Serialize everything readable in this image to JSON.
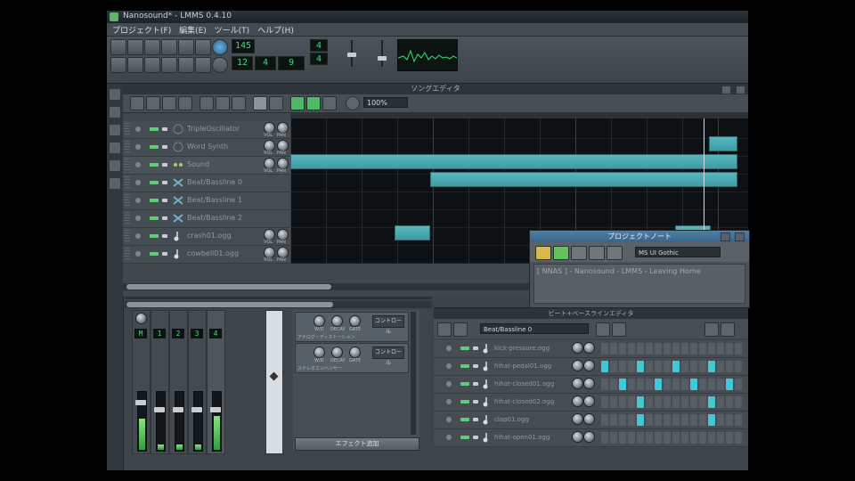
{
  "window": {
    "title": "Nanosound* - LMMS 0.4.10"
  },
  "menubar": {
    "items": [
      "プロジェクト(F)",
      "編集(E)",
      "ツール(T)",
      "ヘルプ(H)"
    ]
  },
  "toolbar": {
    "tempo": "145",
    "time_min": "12",
    "time_sec": "4",
    "time_ms": "9",
    "timesig_num": "4",
    "timesig_den": "4"
  },
  "song_editor": {
    "title": "ソングエディタ",
    "zoom": "100%",
    "tracks": [
      {
        "name": "TripleOscillator",
        "icon": "synth-icon",
        "has_knobs": true,
        "active": false
      },
      {
        "name": "Word Synth",
        "icon": "synth-icon",
        "has_knobs": true,
        "active": false
      },
      {
        "name": "Sound",
        "icon": "sampler-icon",
        "has_knobs": true,
        "active": true
      },
      {
        "name": "Beat/Bassline 0",
        "icon": "beat-icon",
        "has_knobs": false,
        "active": false
      },
      {
        "name": "Beat/Bassline 1",
        "icon": "beat-icon",
        "has_knobs": false,
        "active": false
      },
      {
        "name": "Beat/Bassline 2",
        "icon": "beat-icon",
        "has_knobs": false,
        "active": false
      },
      {
        "name": "crash01.ogg",
        "icon": "note-icon",
        "has_knobs": true,
        "active": false
      },
      {
        "name": "cowbell01.ogg",
        "icon": "note-icon",
        "has_knobs": true,
        "active": false
      }
    ]
  },
  "project_notes": {
    "title": "プロジェクトノート",
    "font": "MS UI Gothic",
    "text": "[ NNAS ] - Nanosound - LMMS - Leaving Home"
  },
  "fx_mixer": {
    "channels": [
      "M",
      "1",
      "2",
      "3",
      "4"
    ],
    "effects": [
      {
        "name": "アナログ・ディストーション",
        "control": "コントロール"
      },
      {
        "name": "ステレオエンハンサー",
        "control": "コントロール"
      }
    ],
    "add_effect": "エフェクト追加"
  },
  "beat_editor": {
    "title": "ビート+ベースラインエディタ",
    "selected": "Beat/Bassline 0",
    "rows": [
      {
        "name": "kick-pressure.ogg",
        "steps": [
          0,
          0,
          0,
          0,
          0,
          0,
          0,
          0,
          0,
          0,
          0,
          0,
          0,
          0,
          0,
          0
        ]
      },
      {
        "name": "hihat-pedal01.ogg",
        "steps": [
          1,
          0,
          0,
          0,
          1,
          0,
          0,
          0,
          1,
          0,
          0,
          0,
          1,
          0,
          0,
          0
        ]
      },
      {
        "name": "hihat-closed01.ogg",
        "steps": [
          0,
          0,
          1,
          0,
          0,
          0,
          1,
          0,
          0,
          0,
          1,
          0,
          0,
          0,
          1,
          0
        ]
      },
      {
        "name": "hihat-closed02.ogg",
        "steps": [
          0,
          0,
          0,
          0,
          1,
          0,
          0,
          0,
          0,
          0,
          0,
          0,
          1,
          0,
          0,
          0
        ]
      },
      {
        "name": "clap01.ogg",
        "steps": [
          0,
          0,
          0,
          0,
          1,
          0,
          0,
          0,
          0,
          0,
          0,
          0,
          1,
          0,
          0,
          0
        ]
      },
      {
        "name": "hihat-open01.ogg",
        "steps": [
          0,
          0,
          0,
          0,
          0,
          0,
          0,
          0,
          0,
          0,
          0,
          0,
          0,
          0,
          0,
          0
        ]
      }
    ],
    "step_on_color": "#3ec8d8",
    "step_off_color": "#555e64"
  },
  "knob_labels": {
    "vol": "VOL",
    "pan": "PAN",
    "w_d": "W/D",
    "decay": "DECAY",
    "gate": "GATE"
  }
}
